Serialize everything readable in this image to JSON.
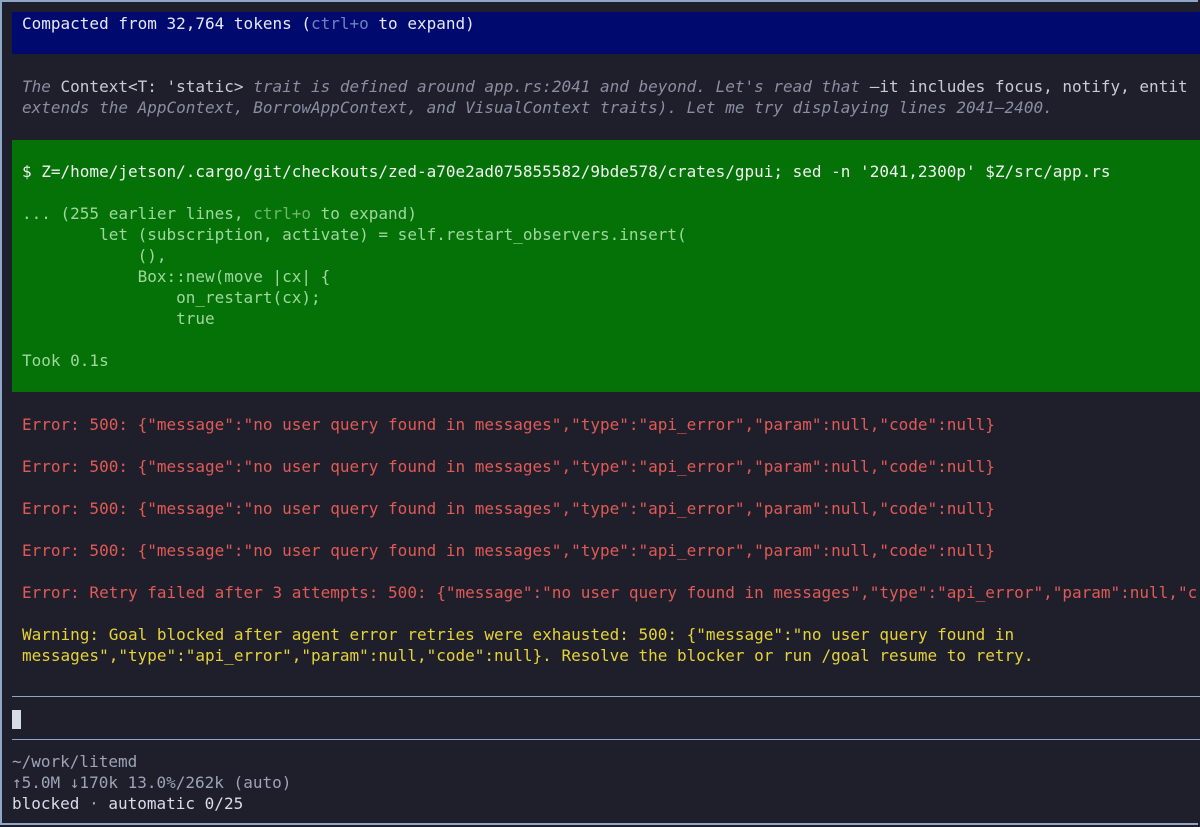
{
  "compacted": {
    "prefix": "Compacted from 32,764 tokens (",
    "shortcut": "ctrl+o",
    "suffix": " to expand)"
  },
  "thinking": {
    "line1_a": "The ",
    "line1_b": "Context<T: 'static>",
    "line1_c": " trait is defined around app.rs:2041 and beyond. Let's read that ",
    "line1_d": "—it includes focus, notify, entit",
    "line2": "extends the AppContext, BorrowAppContext, and VisualContext traits). Let me try displaying lines 2041–2400."
  },
  "command": {
    "text": "$ Z=/home/jetson/.cargo/git/checkouts/zed-a70e2ad075855582/9bde578/crates/gpui; sed -n '2041,2300p' $Z/src/app.rs",
    "collapsed_prefix": "... (255 earlier lines, ",
    "collapsed_shortcut": "ctrl+o",
    "collapsed_suffix": " to expand)",
    "output_lines": [
      "        let (subscription, activate) = self.restart_observers.insert(",
      "            (),",
      "            Box::new(move |cx| {",
      "                on_restart(cx);",
      "                true"
    ],
    "took": "Took 0.1s"
  },
  "errors": [
    "Error: 500: {\"message\":\"no user query found in messages\",\"type\":\"api_error\",\"param\":null,\"code\":null}",
    "Error: 500: {\"message\":\"no user query found in messages\",\"type\":\"api_error\",\"param\":null,\"code\":null}",
    "Error: 500: {\"message\":\"no user query found in messages\",\"type\":\"api_error\",\"param\":null,\"code\":null}",
    "Error: 500: {\"message\":\"no user query found in messages\",\"type\":\"api_error\",\"param\":null,\"code\":null}",
    "Error: Retry failed after 3 attempts: 500: {\"message\":\"no user query found in messages\",\"type\":\"api_error\",\"param\":null,\"c"
  ],
  "warning": {
    "line1": "Warning: Goal blocked after agent error retries were exhausted: 500: {\"message\":\"no user query found in",
    "line2": "messages\",\"type\":\"api_error\",\"param\":null,\"code\":null}. Resolve the blocker or run /goal resume to retry."
  },
  "input": {
    "value": ""
  },
  "status": {
    "cwd": "~/work/litemd",
    "tokens": "↑5.0M ↓170k 13.0%/262k (auto)",
    "mode": "blocked",
    "separator": " · ",
    "automatic": "automatic 0/25"
  },
  "colors": {
    "background": "#1e1f2b",
    "compact_bar": "#000a6e",
    "command_block": "#047207",
    "error": "#e05a56",
    "warning": "#e6d23a",
    "rule": "#8ea6c8"
  }
}
